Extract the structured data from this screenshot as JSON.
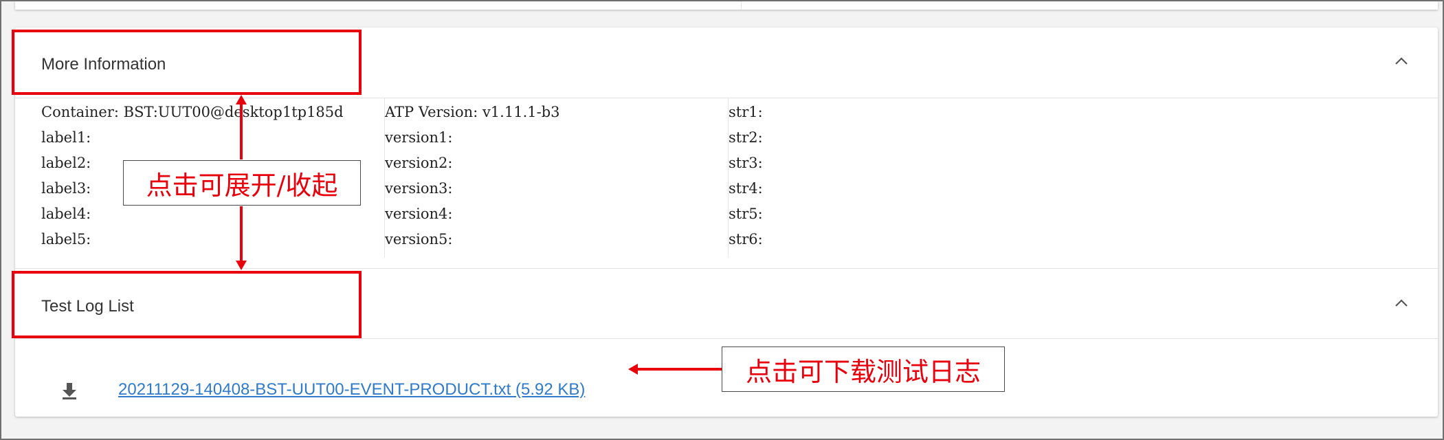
{
  "panels": {
    "more_info": {
      "title": "More Information",
      "collapse_icon": "chevron-up-icon",
      "columns": [
        [
          "Container: BST:UUT00@desktop1tp185d",
          "label1:",
          "label2:",
          "label3:",
          "label4:",
          "label5:"
        ],
        [
          "ATP Version: v1.11.1-b3",
          "version1:",
          "version2:",
          "version3:",
          "version4:",
          "version5:"
        ],
        [
          "str1:",
          "str2:",
          "str3:",
          "str4:",
          "str5:",
          "str6:"
        ]
      ]
    },
    "test_log": {
      "title": "Test Log List",
      "collapse_icon": "chevron-up-icon",
      "download_icon": "download-icon",
      "log_file": "20211129-140408-BST-UUT00-EVENT-PRODUCT.txt (5.92 KB)"
    }
  },
  "annotations": {
    "expand_collapse": "点击可展开/收起",
    "download_log": "点击可下载测试日志",
    "highlight_color": "#e8000c"
  }
}
